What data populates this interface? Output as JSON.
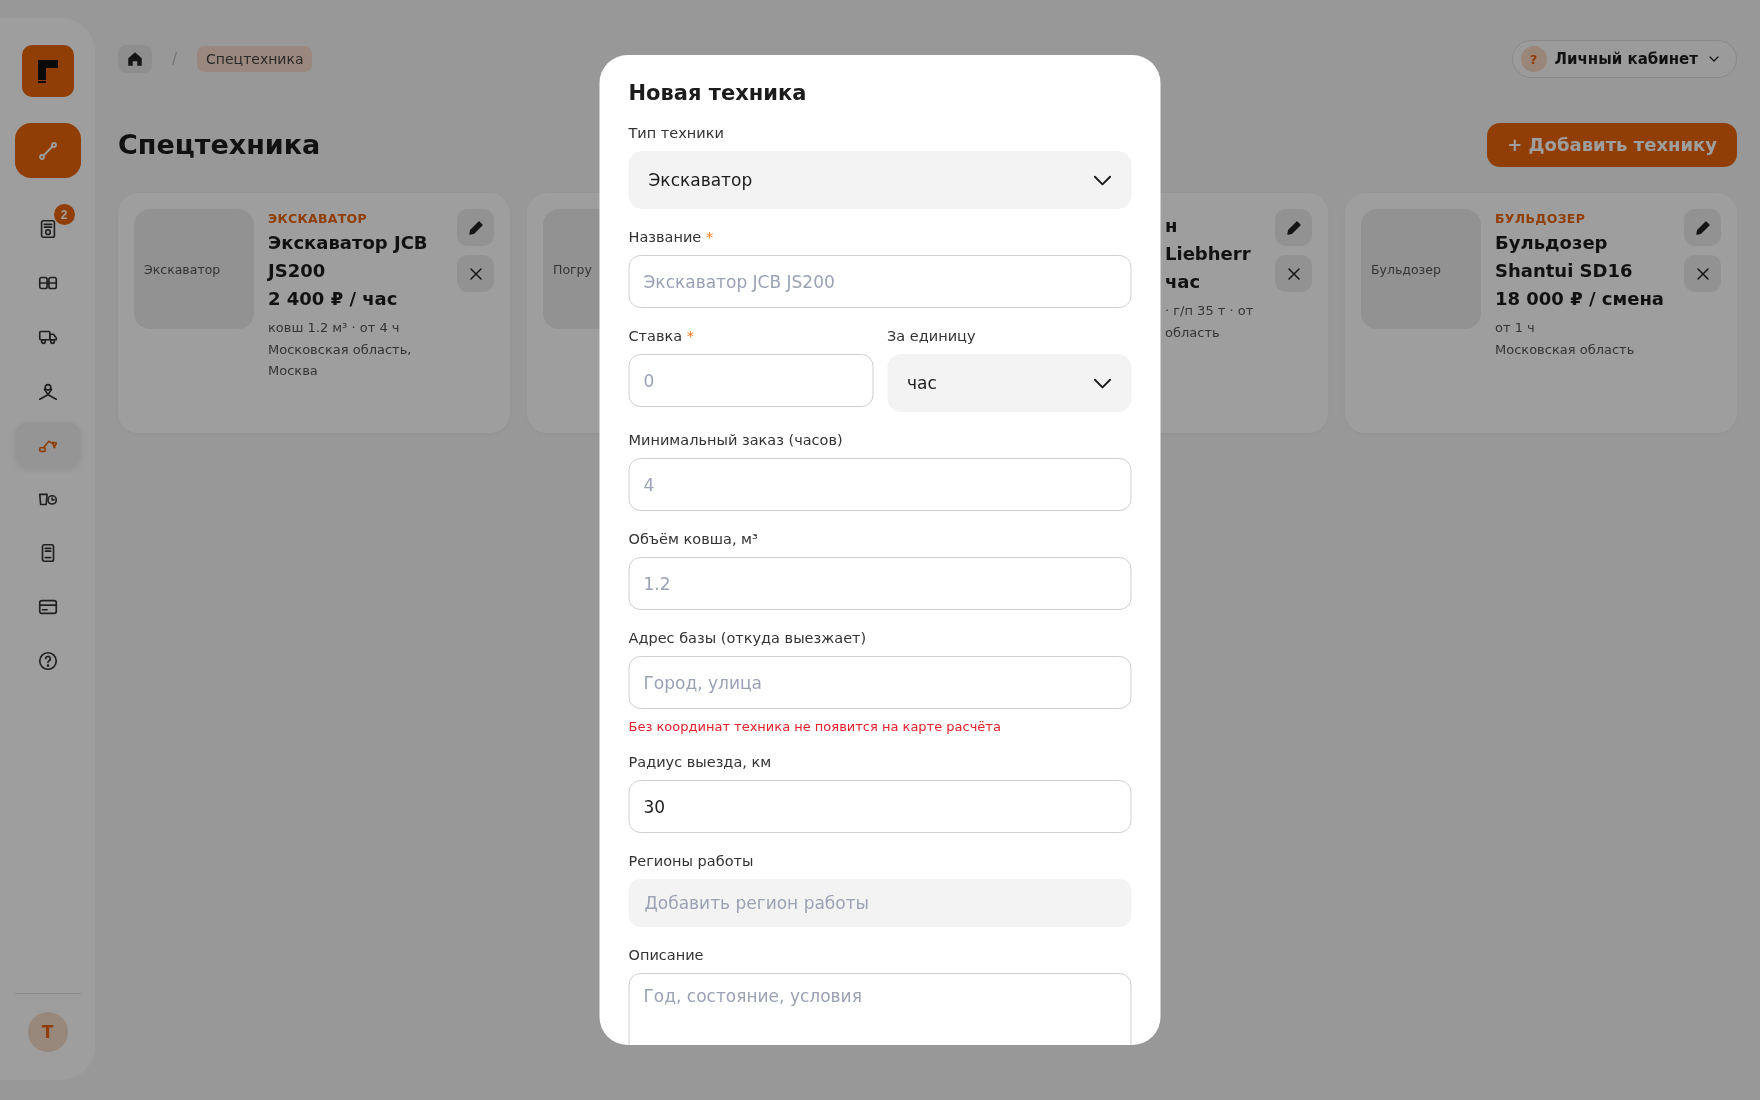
{
  "sidebar": {
    "nav": [
      {
        "selected": false,
        "badge": "2"
      },
      {
        "selected": false
      },
      {
        "selected": false
      },
      {
        "selected": false
      },
      {
        "selected": true
      },
      {
        "selected": false
      },
      {
        "selected": false
      },
      {
        "selected": false
      },
      {
        "selected": false
      }
    ],
    "avatar": "Т"
  },
  "breadcrumbs": {
    "separator": "/",
    "items": [
      {
        "label": "Спецтехника"
      }
    ]
  },
  "account": {
    "avatar": "?",
    "label": "Личный кабинет"
  },
  "title": "Спецтехника",
  "add_button": "+ Добавить технику",
  "cards": [
    {
      "category": "ЭКСКАВАТОР",
      "image_label": "Экскаватор",
      "title": "Экскаватор JCB JS200",
      "price": "2 400 ₽ / час",
      "specs": "ковш 1.2 м³ · от 4 ч",
      "location": "Московская область, Москва"
    },
    {
      "image_label": "Погру"
    },
    {
      "title": "н Liebherr",
      "price": "час",
      "specs": "· г/п 35 т · от",
      "location": "область"
    },
    {
      "category": "БУЛЬДОЗЕР",
      "image_label": "Бульдозер",
      "title": "Бульдозер Shantui SD16",
      "price": "18 000 ₽ / смена",
      "specs": "от 1 ч",
      "location": "Московская область"
    }
  ],
  "modal": {
    "title": "Новая техника",
    "fields": [
      {
        "kind": "select",
        "label": "Тип техники",
        "value": "Экскаватор"
      },
      {
        "kind": "input",
        "label": "Название",
        "required_mark": "*",
        "placeholder": "Экскаватор JCB JS200"
      },
      {
        "kind": "pair",
        "items": [
          {
            "kind": "input",
            "label": "Ставка",
            "required_mark": "*",
            "placeholder": "0"
          },
          {
            "kind": "select",
            "label": "За единицу",
            "value": "час"
          }
        ]
      },
      {
        "kind": "input",
        "label": "Минимальный заказ (часов)",
        "placeholder": "4"
      },
      {
        "kind": "input",
        "label": "Объём ковша, м³",
        "placeholder": "1.2"
      },
      {
        "kind": "input",
        "label": "Адрес базы (откуда выезжает)",
        "placeholder": "Город, улица",
        "error": "Без координат техника не появится на карте расчёта"
      },
      {
        "kind": "input",
        "label": "Радиус выезда, км",
        "value": "30"
      },
      {
        "kind": "tags",
        "label": "Регионы работы",
        "placeholder": "Добавить регион работы"
      },
      {
        "kind": "textarea",
        "label": "Описание",
        "placeholder": "Год, состояние, условия"
      }
    ]
  }
}
